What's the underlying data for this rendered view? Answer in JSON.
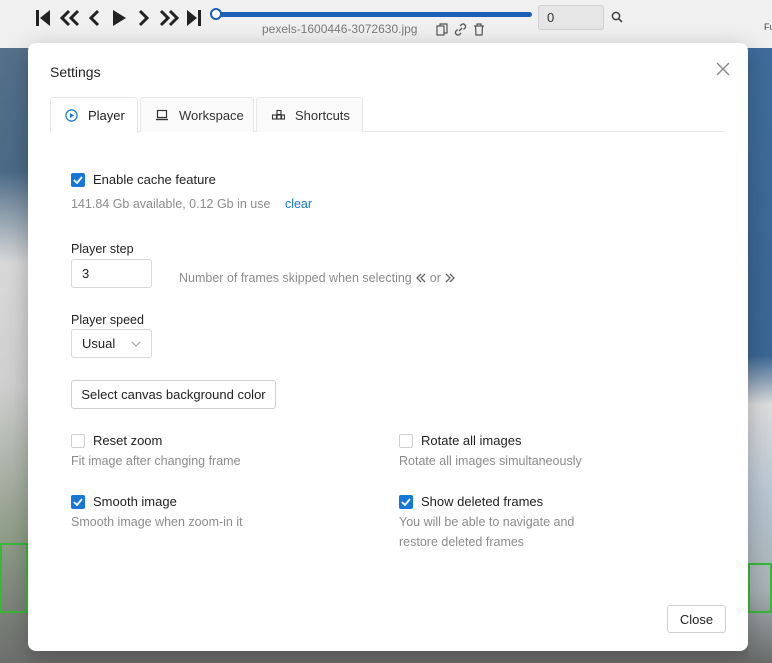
{
  "topbar": {
    "filename": "pexels-1600446-3072630.jpg",
    "frame_value": "0",
    "edge_text": "Fu"
  },
  "modal": {
    "title": "Settings",
    "tabs": [
      {
        "label": "Player",
        "icon": "play-circle-icon"
      },
      {
        "label": "Workspace",
        "icon": "laptop-icon"
      },
      {
        "label": "Shortcuts",
        "icon": "keyboard-icon"
      }
    ],
    "cache": {
      "label": "Enable cache feature",
      "checked": true,
      "status": "141.84 Gb available, 0.12 Gb in use",
      "clear_label": "clear"
    },
    "player_step": {
      "label": "Player step",
      "value": "3",
      "hint_prefix": "Number of frames skipped when selecting",
      "hint_or": "or"
    },
    "player_speed": {
      "label": "Player speed",
      "value": "Usual"
    },
    "canvas_bg_button": "Select canvas background color",
    "options": {
      "reset_zoom": {
        "label": "Reset zoom",
        "checked": false,
        "desc": "Fit image after changing frame"
      },
      "rotate_all": {
        "label": "Rotate all images",
        "checked": false,
        "desc": "Rotate all images simultaneously"
      },
      "smooth_image": {
        "label": "Smooth image",
        "checked": true,
        "desc": "Smooth image when zoom-in it"
      },
      "show_deleted": {
        "label": "Show deleted frames",
        "checked": true,
        "desc_line1": "You will be able to navigate and",
        "desc_line2": "restore deleted frames"
      }
    },
    "close_button": "Close"
  },
  "colors": {
    "accent": "#1677d8",
    "slider": "#1d5fb5",
    "bbox": "#38b838"
  }
}
